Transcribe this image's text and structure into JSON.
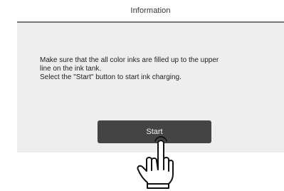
{
  "header": {
    "title": "Information"
  },
  "dialog": {
    "message_lines": [
      "Make sure that the all color inks are filled up to the upper",
      "line on the ink tank.",
      "Select the \"Start\" button to start ink charging."
    ],
    "start_label": "Start"
  },
  "icons": {
    "pointer": "hand-pointer-icon"
  },
  "colors": {
    "dialog_background": "#eeeeee",
    "button_background": "#444444",
    "button_text": "#f2f2f2"
  }
}
